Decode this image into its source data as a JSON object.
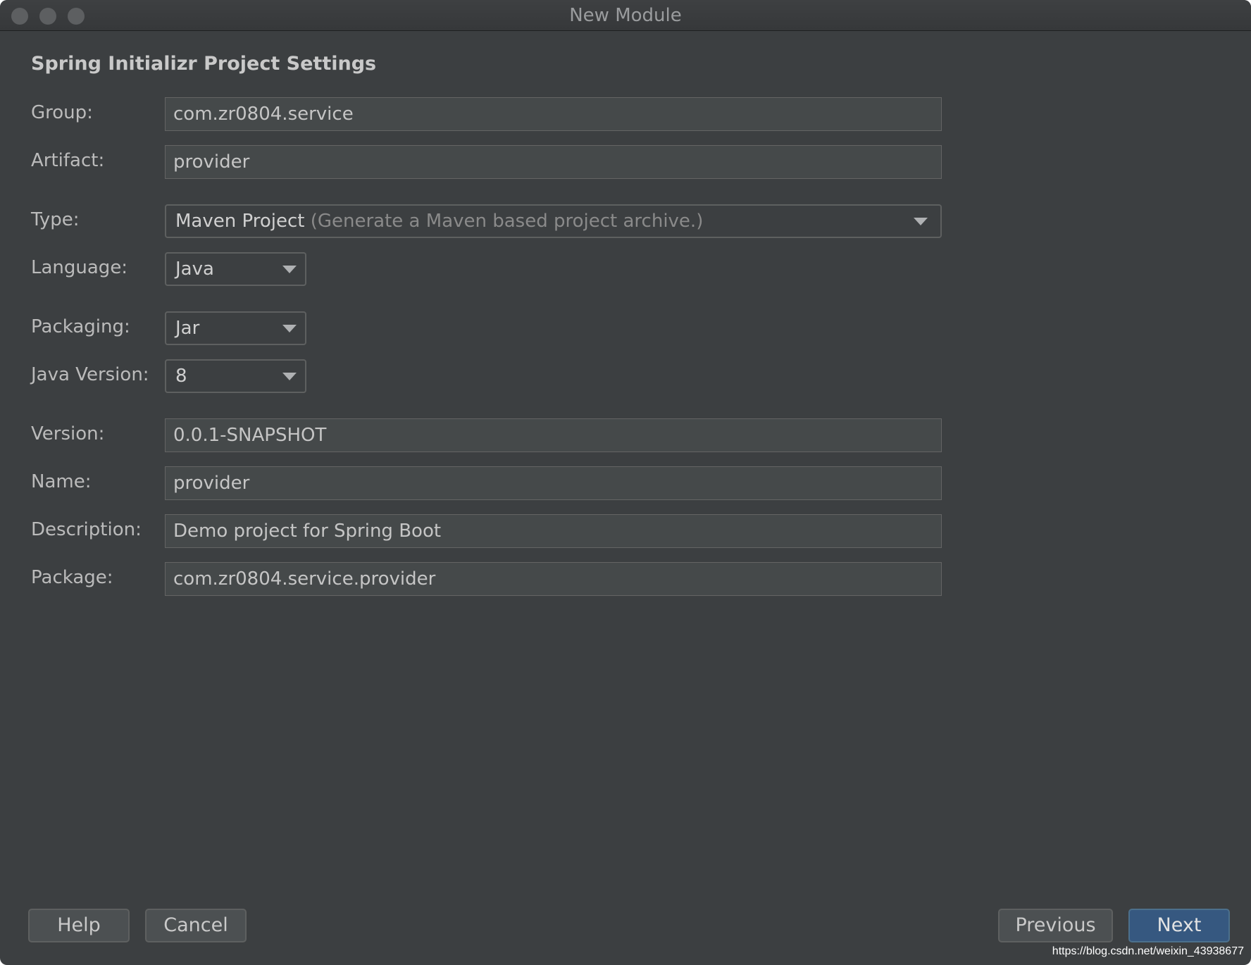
{
  "window": {
    "title": "New Module"
  },
  "section": {
    "title": "Spring Initializr Project Settings"
  },
  "form": {
    "group": {
      "label": "Group:",
      "value": "com.zr0804.service"
    },
    "artifact": {
      "label": "Artifact:",
      "value": "provider"
    },
    "type": {
      "label": "Type:",
      "value": "Maven Project",
      "hint": "(Generate a Maven based project archive.)"
    },
    "language": {
      "label": "Language:",
      "value": "Java"
    },
    "packaging": {
      "label": "Packaging:",
      "value": "Jar"
    },
    "java_version": {
      "label": "Java Version:",
      "value": "8"
    },
    "version": {
      "label": "Version:",
      "value": "0.0.1-SNAPSHOT"
    },
    "name": {
      "label": "Name:",
      "value": "provider"
    },
    "description": {
      "label": "Description:",
      "value": "Demo project for Spring Boot"
    },
    "package": {
      "label": "Package:",
      "value": "com.zr0804.service.provider"
    }
  },
  "buttons": {
    "help": "Help",
    "cancel": "Cancel",
    "previous": "Previous",
    "next": "Next"
  },
  "watermark": "https://blog.csdn.net/weixin_43938677",
  "colors": {
    "background": "#3c3f41",
    "field": "#45494a",
    "primary_button": "#365880",
    "text": "#bbbbbb"
  },
  "icons": {
    "dropdown": "chevron-down-icon"
  }
}
